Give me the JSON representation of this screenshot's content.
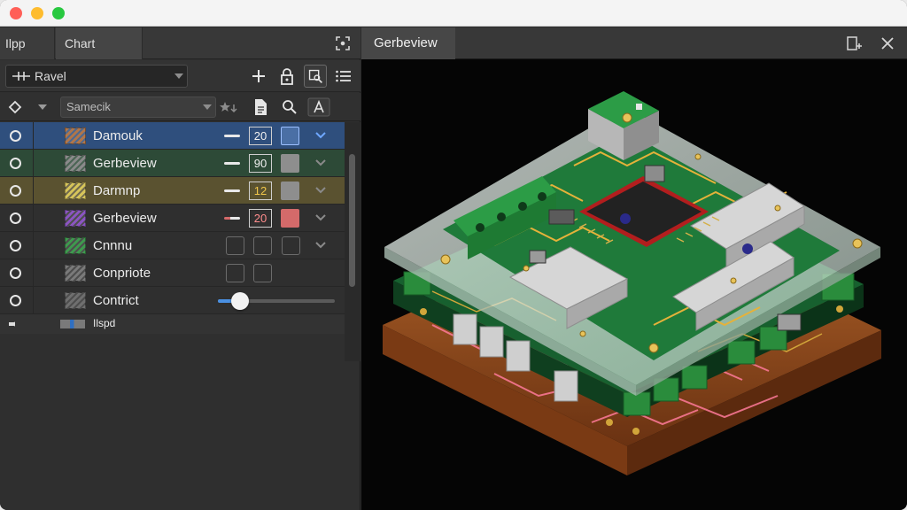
{
  "left_panel": {
    "tabs": [
      "Ilpp",
      "Chart"
    ],
    "layer_select": {
      "value": "Ravel"
    },
    "filter_select": {
      "value": "Samecik"
    },
    "layers": [
      {
        "name": "Damouk",
        "swatch": "#b0764a",
        "value": "20",
        "color": "#4a6fa5",
        "row_bg": "#2f4f7d",
        "chevron": "#6fa8ff"
      },
      {
        "name": "Gerbeview",
        "swatch": "#8a8a8a",
        "value": "90",
        "color": "#8e8e8e",
        "row_bg": "#2d4a37",
        "chevron": "#8a8a8a"
      },
      {
        "name": "Darmnp",
        "swatch": "#d6c45a",
        "value": "12",
        "color": "#8e8e8e",
        "row_bg": "#5a5230",
        "chevron": "#8a8a8a"
      },
      {
        "name": "Gerbeview",
        "swatch": "#8b55c2",
        "value": "20",
        "color": "#d46a6a",
        "row_bg": "#2f2f2f",
        "chevron": "#8a8a8a"
      },
      {
        "name": "Cnnnu",
        "swatch": "#3e9a4e",
        "row_bg": "#2f2f2f"
      },
      {
        "name": "Conprіote",
        "swatch": "#7a7a7a",
        "row_bg": "#2f2f2f"
      },
      {
        "name": "Contrict",
        "swatch": "#6f6f6f",
        "row_bg": "#2f2f2f",
        "slider": 0.19
      }
    ],
    "footer": {
      "label": "Ilspd"
    }
  },
  "right_panel": {
    "tab": "Gerbeview"
  },
  "colors": {
    "accent": "#4a90e2",
    "pcb_green": "#1d6b35",
    "pcb_copper": "#b05a1e",
    "silkscreen": "#f0f0f0"
  }
}
